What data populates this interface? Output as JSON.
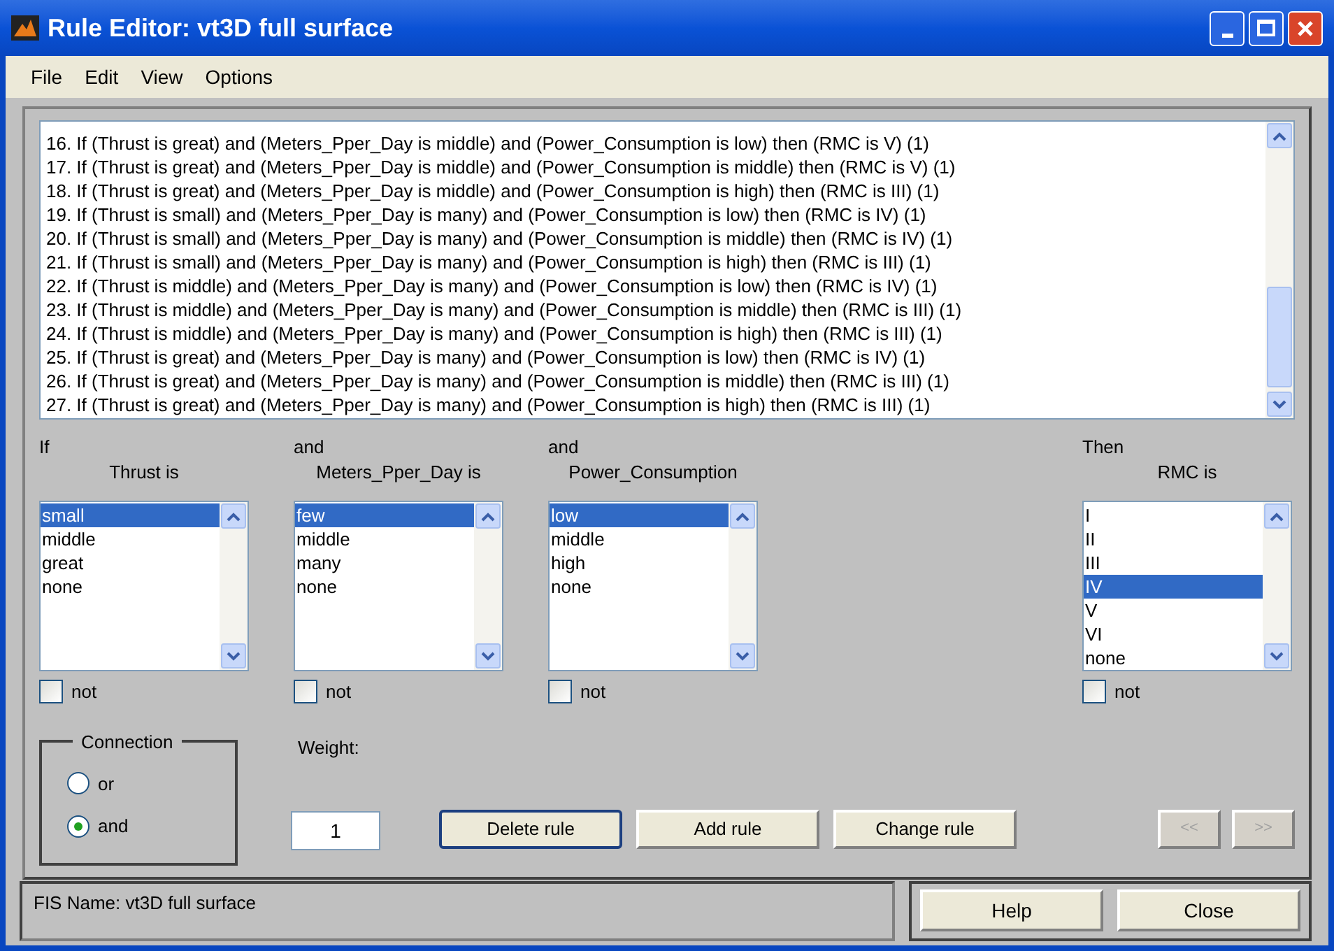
{
  "window": {
    "title": "Rule Editor: vt3D full surface"
  },
  "menu": [
    "File",
    "Edit",
    "View",
    "Options"
  ],
  "rules": [
    "16. If (Thrust is great) and (Meters_Pper_Day is middle) and (Power_Consumption is low) then (RMC is V) (1)",
    "17. If (Thrust is great) and (Meters_Pper_Day is middle) and (Power_Consumption is middle) then (RMC is V) (1)",
    "18. If (Thrust is great) and (Meters_Pper_Day is middle) and (Power_Consumption is high) then (RMC is III) (1)",
    "19. If (Thrust is small) and (Meters_Pper_Day is many) and (Power_Consumption is low) then (RMC is IV) (1)",
    "20. If (Thrust is small) and (Meters_Pper_Day is many) and (Power_Consumption is middle) then (RMC is IV) (1)",
    "21. If (Thrust is small) and (Meters_Pper_Day is many) and (Power_Consumption is high) then (RMC is III) (1)",
    "22. If (Thrust is middle) and (Meters_Pper_Day is many) and (Power_Consumption is low) then (RMC is IV) (1)",
    "23. If (Thrust is middle) and (Meters_Pper_Day is many) and (Power_Consumption is middle) then (RMC is III) (1)",
    "24. If (Thrust is middle) and (Meters_Pper_Day is many) and (Power_Consumption is high) then (RMC is III) (1)",
    "25. If (Thrust is great) and (Meters_Pper_Day is many) and (Power_Consumption is low) then (RMC is IV) (1)",
    "26. If (Thrust is great) and (Meters_Pper_Day is many) and (Power_Consumption is middle) then (RMC is III) (1)",
    "27. If (Thrust is great) and (Meters_Pper_Day is many) and (Power_Consumption is high) then (RMC is III) (1)"
  ],
  "antecedents": [
    {
      "prefix": "If",
      "label": "Thrust is",
      "not_label": "not",
      "not_checked": false,
      "options": [
        {
          "label": "small",
          "selected": true
        },
        {
          "label": "middle",
          "selected": false
        },
        {
          "label": "great",
          "selected": false
        },
        {
          "label": "none",
          "selected": false
        }
      ]
    },
    {
      "prefix": "and",
      "label": "Meters_Pper_Day is",
      "not_label": "not",
      "not_checked": false,
      "options": [
        {
          "label": "few",
          "selected": true
        },
        {
          "label": "middle",
          "selected": false
        },
        {
          "label": "many",
          "selected": false
        },
        {
          "label": "none",
          "selected": false
        }
      ]
    },
    {
      "prefix": "and",
      "label": "Power_Consumption",
      "not_label": "not",
      "not_checked": false,
      "options": [
        {
          "label": "low",
          "selected": true
        },
        {
          "label": "middle",
          "selected": false
        },
        {
          "label": "high",
          "selected": false
        },
        {
          "label": "none",
          "selected": false
        }
      ]
    }
  ],
  "consequent": {
    "prefix": "Then",
    "label": "RMC is",
    "not_label": "not",
    "not_checked": false,
    "options": [
      {
        "label": "I",
        "selected": false
      },
      {
        "label": "II",
        "selected": false
      },
      {
        "label": "III",
        "selected": false
      },
      {
        "label": "IV",
        "selected": true
      },
      {
        "label": "V",
        "selected": false
      },
      {
        "label": "VI",
        "selected": false
      },
      {
        "label": "none",
        "selected": false
      }
    ]
  },
  "connection": {
    "title": "Connection",
    "options": [
      {
        "label": "or",
        "selected": false
      },
      {
        "label": "and",
        "selected": true
      }
    ]
  },
  "weight": {
    "label": "Weight:",
    "value": "1"
  },
  "buttons": [
    {
      "label": "Delete rule",
      "focused": true,
      "disabled": false
    },
    {
      "label": "Add rule",
      "focused": false,
      "disabled": false
    },
    {
      "label": "Change rule",
      "focused": false,
      "disabled": false
    }
  ],
  "nav_buttons": [
    {
      "label": "<<",
      "disabled": true
    },
    {
      "label": ">>",
      "disabled": true
    }
  ],
  "status": "FIS Name: vt3D full surface",
  "dialog_buttons": [
    "Help",
    "Close"
  ]
}
